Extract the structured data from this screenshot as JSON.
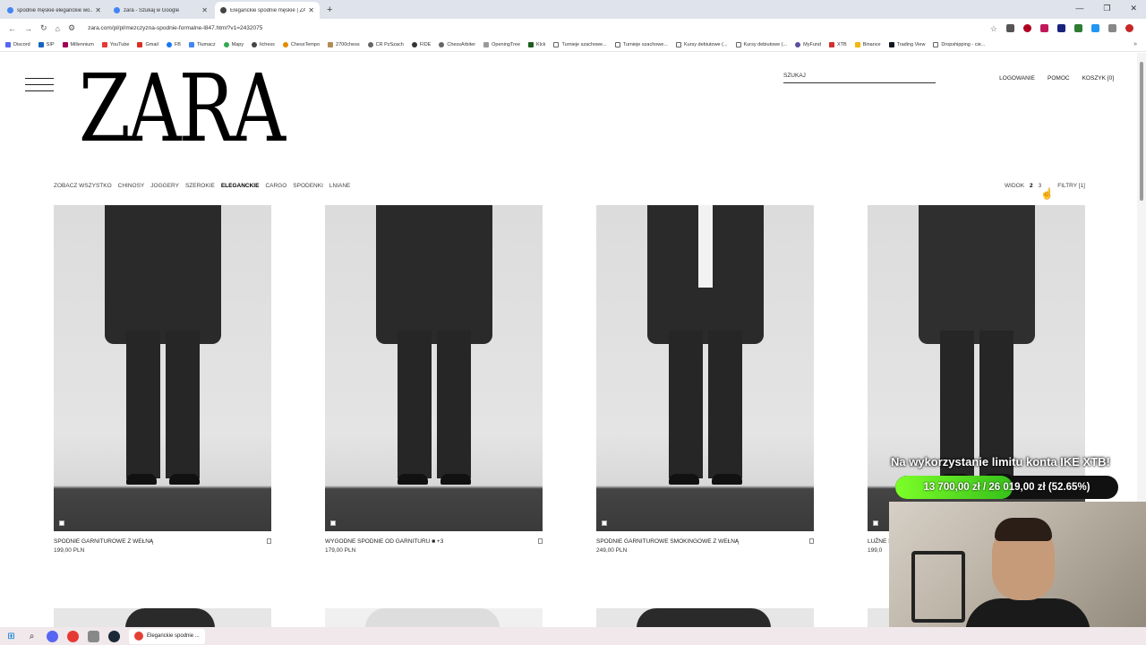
{
  "browser": {
    "tabs": [
      {
        "title": "spodnie męskie eleganckie wo...",
        "favicon_color": "#4285f4",
        "active": false
      },
      {
        "title": "zara - Szukaj w Google",
        "favicon_color": "#4285f4",
        "active": false
      },
      {
        "title": "Eleganckie spodnie męskie | ZA...",
        "favicon_color": "#444444",
        "active": true
      }
    ],
    "new_tab": "+",
    "url": "zara.com/pl/pl/mezczyzna-spodnie-formalne-l847.html?v1=2432075",
    "bookmarks": [
      "Discord",
      "SIP",
      "Millennium",
      "YouTube",
      "Gmail",
      "FB",
      "Tłumacz",
      "Mapy",
      "lichess",
      "ChessTempo",
      "2700chess",
      "CR PzSzach",
      "FIDE",
      "ChessArbiter",
      "OpeningTree",
      "Klck",
      "Turnieje szachowe...",
      "Turnieje szachowe...",
      "Kursy debiutowe (...",
      "Kursy debiutowe (...",
      "MyFund",
      "XTB",
      "Binance",
      "Trading View",
      "Dropshipping - cie..."
    ]
  },
  "site": {
    "logo": "ZARA",
    "search_placeholder": "SZUKAJ",
    "nav": {
      "login": "LOGOWANIE",
      "help": "POMOC",
      "cart": "KOSZYK [0]"
    },
    "categories": [
      "ZOBACZ WSZYSTKO",
      "CHINOSY",
      "JOGGERY",
      "SZEROKIE",
      "ELEGANCKIE",
      "CARGO",
      "SPODENKI",
      "LNIANE"
    ],
    "selected_category": "ELEGANCKIE",
    "view": {
      "label": "WIDOK",
      "opt2": "2",
      "opt3": "3",
      "filters": "FILTRY [1]"
    },
    "products": [
      {
        "name": "SPODNIE GARNITUROWE Z WEŁNĄ",
        "price": "199,00 PLN",
        "extra": ""
      },
      {
        "name": "WYGODNE SPODNIE OD GARNITURU",
        "price": "179,00 PLN",
        "extra": "■ +3"
      },
      {
        "name": "SPODNIE GARNITUROWE SMOKINGOWE Z WEŁNĄ",
        "price": "249,00 PLN",
        "extra": ""
      },
      {
        "name": "LUŹNE S",
        "price": "199,0",
        "extra": ""
      }
    ]
  },
  "overlay": {
    "title": "Na wykorzystanie limitu konta IKE XTB!",
    "progress_text": "13 700,00 zł / 26 019,00 zł (52.65%)",
    "progress_fraction": 0.5265
  },
  "taskbar": {
    "app_label": "Eleganckie spodnie ..."
  }
}
